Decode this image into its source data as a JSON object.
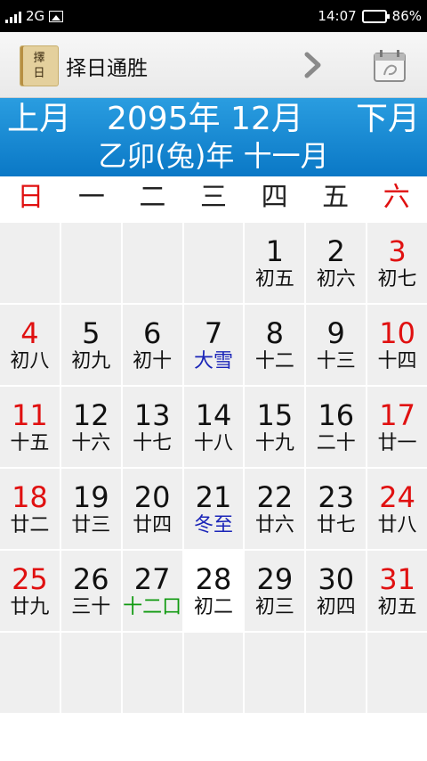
{
  "status_bar": {
    "network": "2G",
    "time": "14:07",
    "battery": "86%",
    "battery_level": 0.86
  },
  "app_bar": {
    "logo_text": "擇日",
    "title": "择日通胜",
    "next_icon": "chevron-right-icon",
    "calendar_icon": "calendar-icon"
  },
  "banner": {
    "prev_label": "上月",
    "month_title": "2095年 12月",
    "next_label": "下月",
    "lunar_title": "乙卯(兔)年 十一月"
  },
  "weekdays": [
    "日",
    "一",
    "二",
    "三",
    "四",
    "五",
    "六"
  ],
  "colors": {
    "red": "#e01010",
    "blue": "#1b25b8",
    "green": "#109a10",
    "banner": "#1a8ad6"
  },
  "weeks": [
    [
      {
        "day": "",
        "lunar": ""
      },
      {
        "day": "",
        "lunar": ""
      },
      {
        "day": "",
        "lunar": ""
      },
      {
        "day": "",
        "lunar": ""
      },
      {
        "day": "1",
        "lunar": "初五"
      },
      {
        "day": "2",
        "lunar": "初六"
      },
      {
        "day": "3",
        "lunar": "初七",
        "red": true
      }
    ],
    [
      {
        "day": "4",
        "lunar": "初八",
        "red": true
      },
      {
        "day": "5",
        "lunar": "初九"
      },
      {
        "day": "6",
        "lunar": "初十"
      },
      {
        "day": "7",
        "lunar": "大雪",
        "term": true
      },
      {
        "day": "8",
        "lunar": "十二"
      },
      {
        "day": "9",
        "lunar": "十三"
      },
      {
        "day": "10",
        "lunar": "十四",
        "red": true
      }
    ],
    [
      {
        "day": "11",
        "lunar": "十五",
        "red": true
      },
      {
        "day": "12",
        "lunar": "十六"
      },
      {
        "day": "13",
        "lunar": "十七"
      },
      {
        "day": "14",
        "lunar": "十八"
      },
      {
        "day": "15",
        "lunar": "十九"
      },
      {
        "day": "16",
        "lunar": "二十"
      },
      {
        "day": "17",
        "lunar": "廿一",
        "red": true
      }
    ],
    [
      {
        "day": "18",
        "lunar": "廿二",
        "red": true
      },
      {
        "day": "19",
        "lunar": "廿三"
      },
      {
        "day": "20",
        "lunar": "廿四"
      },
      {
        "day": "21",
        "lunar": "冬至",
        "term": true
      },
      {
        "day": "22",
        "lunar": "廿六"
      },
      {
        "day": "23",
        "lunar": "廿七"
      },
      {
        "day": "24",
        "lunar": "廿八",
        "red": true
      }
    ],
    [
      {
        "day": "25",
        "lunar": "廿九",
        "red": true
      },
      {
        "day": "26",
        "lunar": "三十"
      },
      {
        "day": "27",
        "lunar": "十二口",
        "month_start": true
      },
      {
        "day": "28",
        "lunar": "初二",
        "today": true
      },
      {
        "day": "29",
        "lunar": "初三"
      },
      {
        "day": "30",
        "lunar": "初四"
      },
      {
        "day": "31",
        "lunar": "初五",
        "red": true
      }
    ],
    [
      {
        "day": "",
        "lunar": ""
      },
      {
        "day": "",
        "lunar": ""
      },
      {
        "day": "",
        "lunar": ""
      },
      {
        "day": "",
        "lunar": ""
      },
      {
        "day": "",
        "lunar": ""
      },
      {
        "day": "",
        "lunar": ""
      },
      {
        "day": "",
        "lunar": ""
      }
    ]
  ]
}
